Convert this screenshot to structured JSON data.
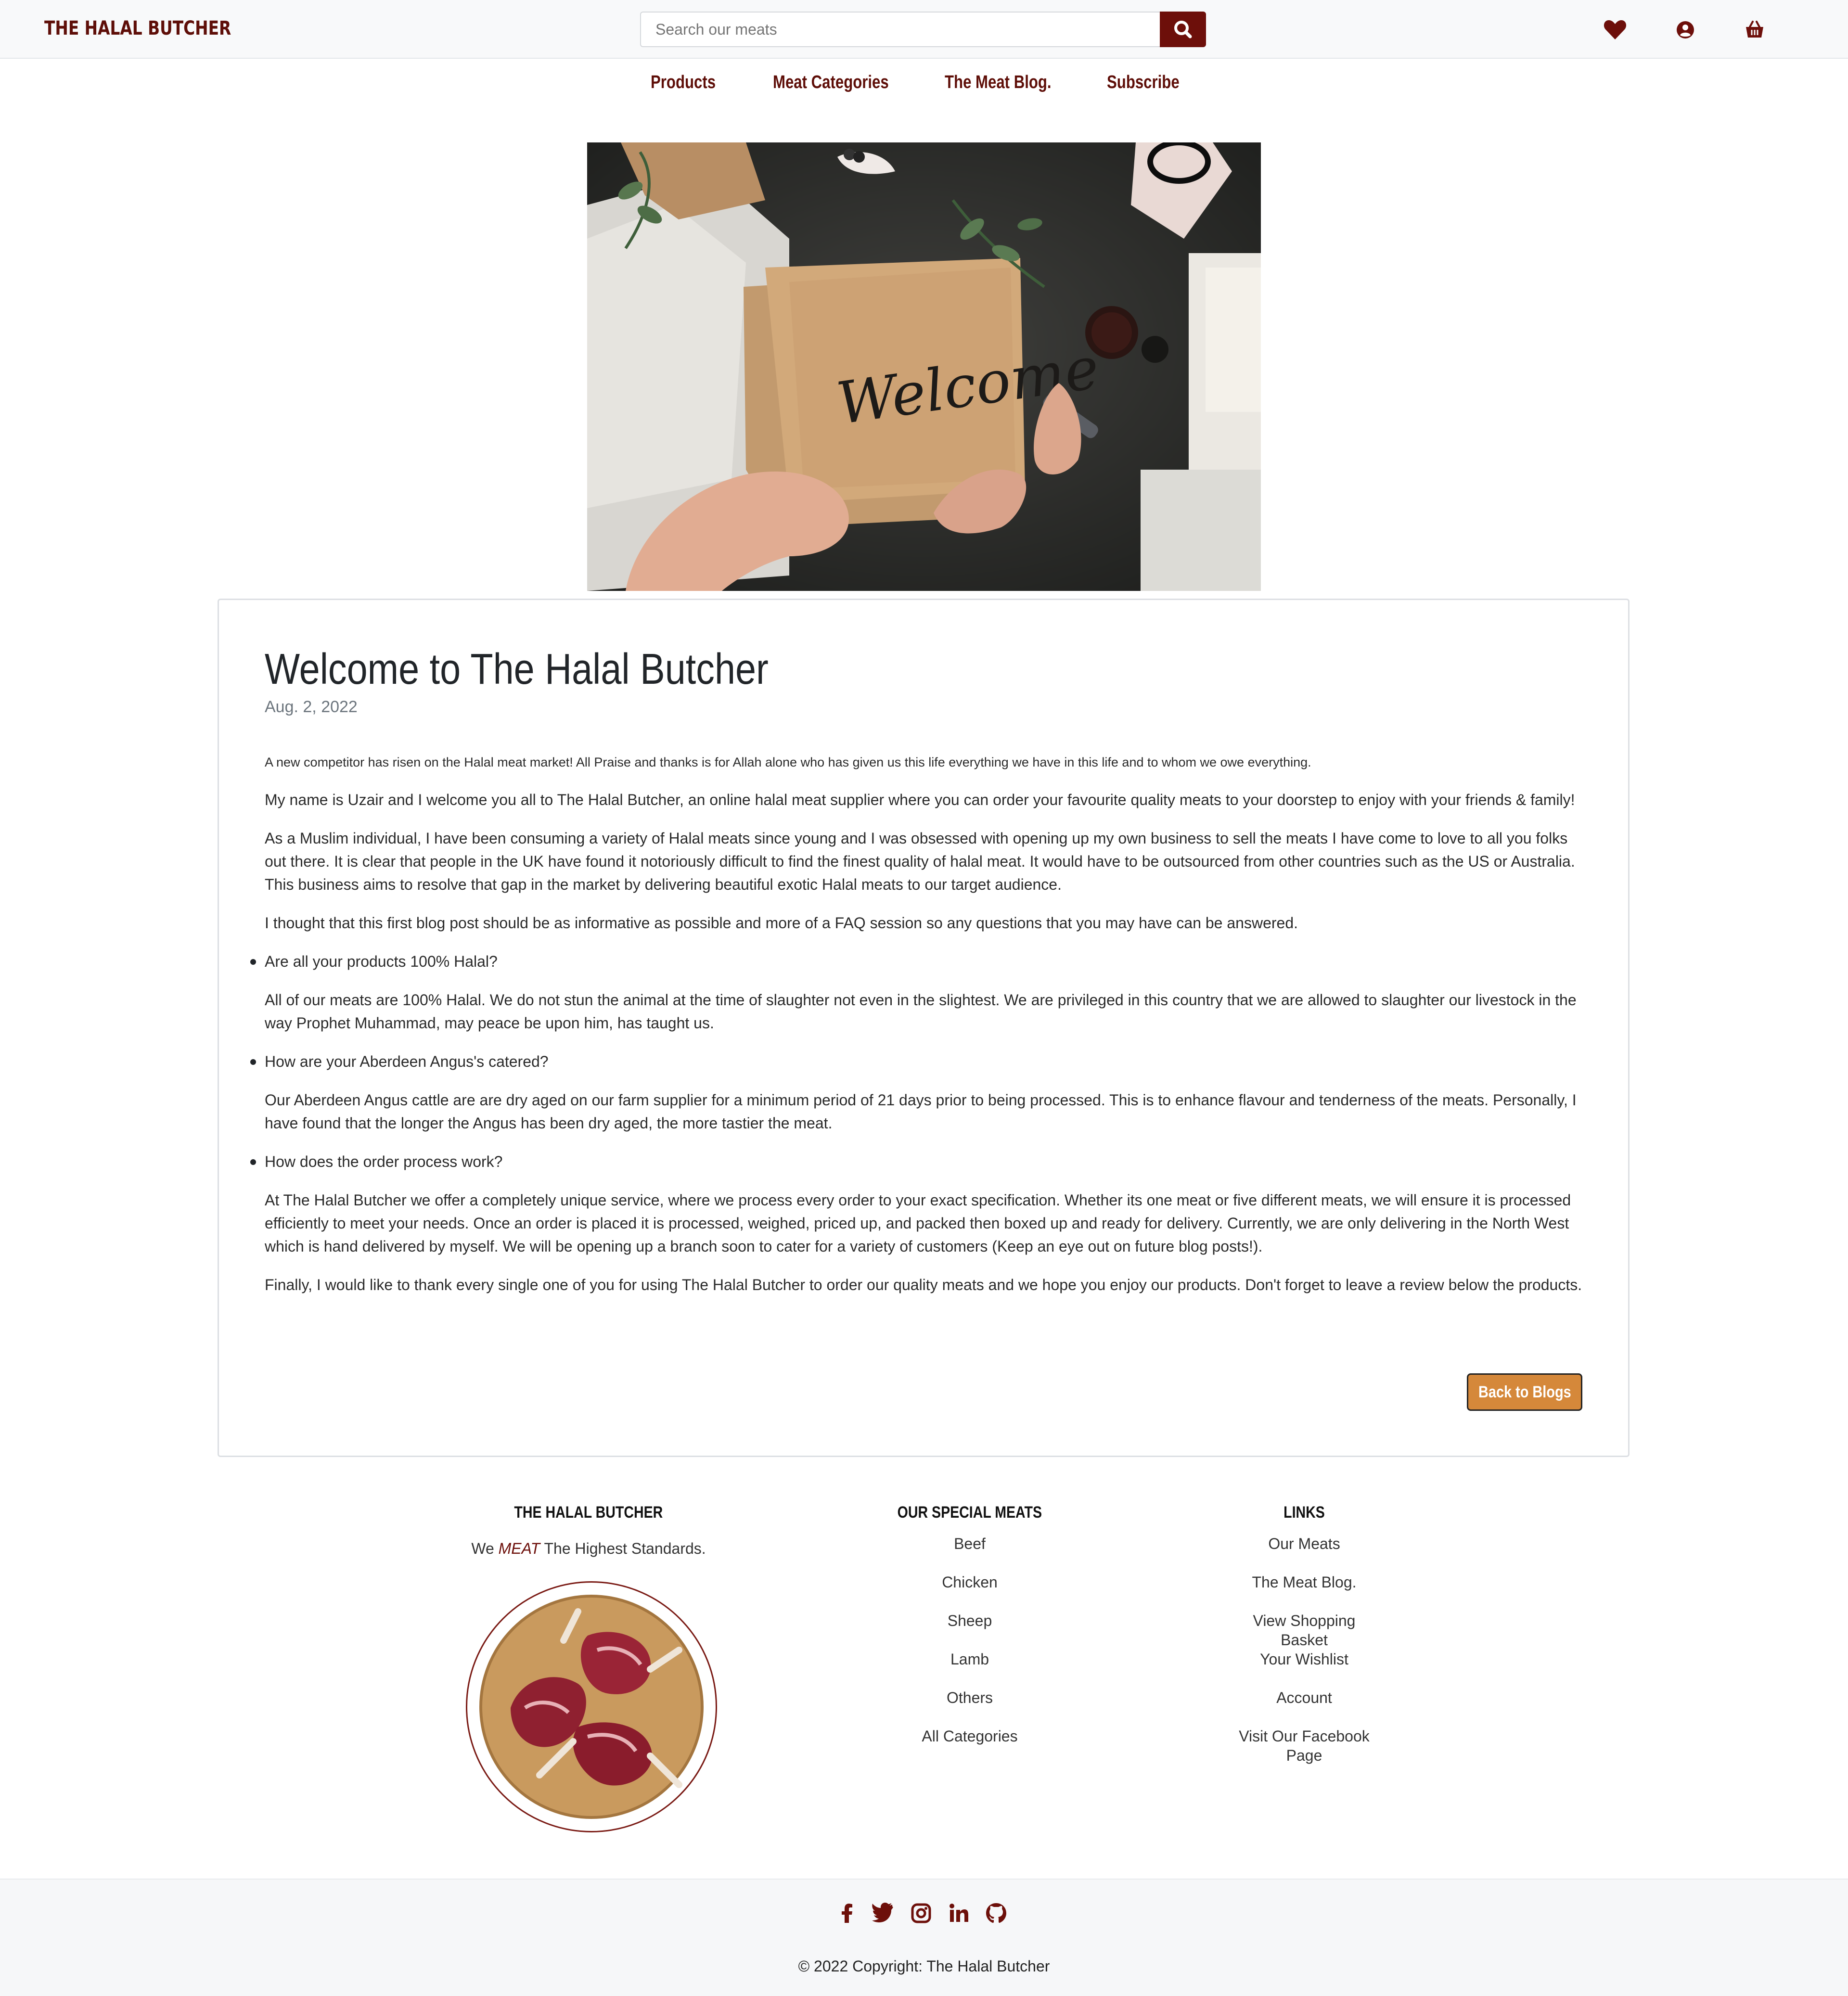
{
  "header": {
    "brand": "THE HALAL BUTCHER",
    "search_placeholder": "Search our meats",
    "icons": [
      "heart-icon",
      "user-circle-icon",
      "shopping-basket-icon"
    ]
  },
  "nav": {
    "items": [
      "Products",
      "Meat Categories",
      "The Meat Blog.",
      "Subscribe"
    ]
  },
  "post": {
    "title": "Welcome to The Halal Butcher",
    "date": "Aug. 2, 2022",
    "lead": "A new competitor has risen on the Halal meat market! All Praise and thanks is for Allah alone who has given us this life everything we have in this life and to whom we owe everything.",
    "p1": "My name is Uzair and I welcome you all to The Halal Butcher, an online halal meat supplier where you can order your favourite quality meats to your doorstep to enjoy with your friends & family!",
    "p2": "As a Muslim individual, I have been consuming a variety of Halal meats since young and I was obsessed with opening up my own business to sell the meats I have come to love to all you folks out there. It is clear that people in the UK have found it notoriously difficult to find the finest quality of halal meat. It would have to be outsourced from other countries such as the US or Australia. This business aims to resolve that gap in the market by delivering beautiful exotic Halal meats to our target audience.",
    "p3": "I thought that this first blog post should be as informative as possible and more of a FAQ session so any questions that you may have can be answered.",
    "q1": "Are all your products 100% Halal?",
    "a1": "All of our meats are 100% Halal. We do not stun the animal at the time of slaughter not even in the slightest. We are privileged in this country that we are allowed to slaughter our livestock in the way Prophet Muhammad, may peace be upon him, has taught us.",
    "q2": "How are your Aberdeen Angus's catered?",
    "a2": "Our Aberdeen Angus cattle are are dry aged on our farm supplier for a minimum period of 21 days prior to being processed. This is to enhance flavour and tenderness of the meats. Personally, I have found that the longer the Angus has been dry aged, the more tastier the meat.",
    "q3": "How does the order process work?",
    "a3": "At The Halal Butcher we offer a completely unique service, where we process every order to your exact specification. Whether its one meat or five different meats, we will ensure it is processed efficiently to meet your needs. Once an order is placed it is processed, weighed, priced up, and packed then boxed up and ready for delivery. Currently, we are only delivering in the North West which is hand delivered by myself. We will be opening up a branch soon to cater for a variety of customers (Keep an eye out on future blog posts!).",
    "p4": "Finally, I would like to thank every single one of you for using The Halal Butcher to order our quality meats and we hope you enjoy our products. Don't forget to leave a review below the products.",
    "back_button": "Back to Blogs",
    "hero_word": "Welcome"
  },
  "footer": {
    "col1": {
      "title": "THE HALAL BUTCHER",
      "tag_before": "We",
      "tag_meat": "MEAT",
      "tag_after": "The Highest Standards."
    },
    "col2": {
      "title": "OUR SPECIAL MEATS",
      "items": [
        "Beef",
        "Chicken",
        "Sheep",
        "Lamb",
        "Others",
        "All Categories"
      ]
    },
    "col3": {
      "title": "LINKS",
      "items": [
        "Our Meats",
        "The Meat Blog.",
        "View Shopping Basket",
        "Your Wishlist",
        "Account",
        "Visit Our Facebook Page"
      ]
    },
    "social": [
      "facebook-icon",
      "twitter-icon",
      "instagram-icon",
      "linkedin-icon",
      "github-icon"
    ],
    "copyright": "© 2022 Copyright: The Halal Butcher"
  },
  "colors": {
    "brand": "#6d0f0a",
    "button": "#d5883a",
    "topbar": "#f8f9fa"
  }
}
